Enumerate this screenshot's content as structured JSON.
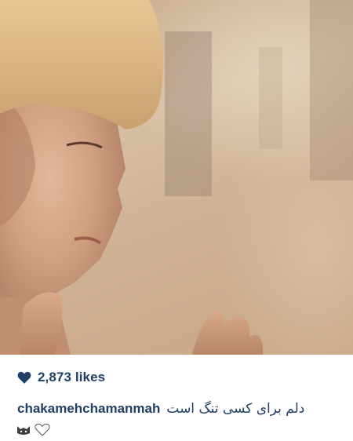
{
  "post": {
    "likes_label": "2,873 likes",
    "username": "chakamehchamanmah",
    "caption": "دلم برای کسی تنگ است"
  },
  "icons": {
    "like": "heart-icon",
    "emoji_1": "hugging-face-emoji-icon",
    "emoji_2": "white-heart-emoji-icon"
  },
  "colors": {
    "text": "#1f3f66",
    "heart": "#1f3f66"
  }
}
